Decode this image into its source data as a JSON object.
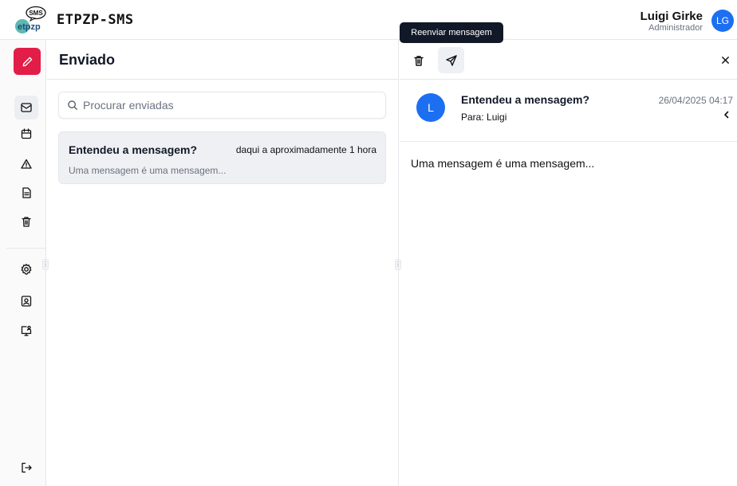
{
  "app": {
    "title": "ETPZP-SMS",
    "logo_text": "SMS",
    "logo_icon": "etpzp-logo"
  },
  "user": {
    "name": "Luigi Girke",
    "role": "Administrador",
    "initials": "LG",
    "avatar_color": "#1d6ff2"
  },
  "sidebar": {
    "compose_icon": "pencil-icon",
    "accent": "#e11d48",
    "items": [
      {
        "icon": "inbox-sent-icon",
        "active": true
      },
      {
        "icon": "calendar-icon",
        "active": false
      },
      {
        "icon": "alert-triangle-icon",
        "active": false
      },
      {
        "icon": "document-icon",
        "active": false
      },
      {
        "icon": "trash-icon",
        "active": false
      },
      {
        "icon": "settings-icon",
        "active": false
      },
      {
        "icon": "contacts-icon",
        "active": false
      },
      {
        "icon": "monitor-user-icon",
        "active": false
      },
      {
        "icon": "logout-icon",
        "active": false
      }
    ]
  },
  "list": {
    "title": "Enviado",
    "search_placeholder": "Procurar enviadas",
    "messages": [
      {
        "subject": "Entendeu a mensagem?",
        "time": "daqui a aproximadamente 1 hora",
        "preview": "Uma mensagem é uma mensagem..."
      }
    ]
  },
  "detail": {
    "tooltip": "Reenviar mensagem",
    "avatar_initial": "L",
    "subject": "Entendeu a mensagem?",
    "to_label": "Para:",
    "to_value": "Luigi",
    "date": "26/04/2025 04:17",
    "body": "Uma mensagem é uma mensagem..."
  }
}
